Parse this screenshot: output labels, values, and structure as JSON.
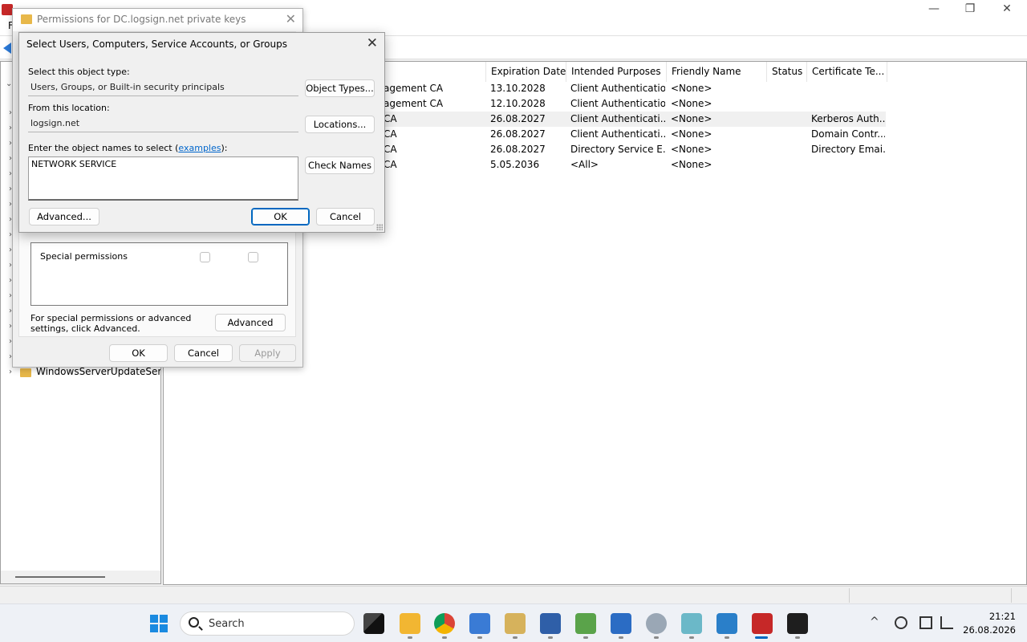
{
  "mmc": {
    "menu_first": "F",
    "window_controls": {
      "minimize": "—",
      "restore": "❐",
      "close": "✕"
    },
    "tree": {
      "folder_label": "WindowsServerUpdateService"
    },
    "columns": [
      "",
      "Expiration Date",
      "Intended Purposes",
      "Friendly Name",
      "Status",
      "Certificate Te..."
    ],
    "rows": [
      {
        "issued_by": "agement CA",
        "expiration": "13.10.2028",
        "purposes": "Client Authentication",
        "friendly": "<None>",
        "status": "",
        "template": ""
      },
      {
        "issued_by": "agement CA",
        "expiration": "12.10.2028",
        "purposes": "Client Authentication",
        "friendly": "<None>",
        "status": "",
        "template": ""
      },
      {
        "issued_by": "CA",
        "expiration": "26.08.2027",
        "purposes": "Client Authenticati...",
        "friendly": "<None>",
        "status": "",
        "template": "Kerberos Auth..."
      },
      {
        "issued_by": "CA",
        "expiration": "26.08.2027",
        "purposes": "Client Authenticati...",
        "friendly": "<None>",
        "status": "",
        "template": "Domain Contr..."
      },
      {
        "issued_by": "CA",
        "expiration": "26.08.2027",
        "purposes": "Directory Service E...",
        "friendly": "<None>",
        "status": "",
        "template": "Directory Emai..."
      },
      {
        "issued_by": "CA",
        "expiration": "5.05.2036",
        "purposes": "<All>",
        "friendly": "<None>",
        "status": "",
        "template": ""
      }
    ]
  },
  "perm_dialog": {
    "title": "Permissions for DC.logsign.net private keys",
    "close": "✕",
    "special_permissions": "Special permissions",
    "advanced_note": "For special permissions or advanced settings, click Advanced.",
    "advanced_button": "Advanced",
    "ok": "OK",
    "cancel": "Cancel",
    "apply": "Apply"
  },
  "select_dialog": {
    "title": "Select Users, Computers, Service Accounts, or Groups",
    "close": "✕",
    "object_type_label": "Select this object type:",
    "object_type_value": "Users, Groups, or Built-in security principals",
    "object_types_button": "Object Types...",
    "location_label": "From this location:",
    "location_value": "logsign.net",
    "locations_button": "Locations...",
    "names_label_prefix": "Enter the object names to select (",
    "names_label_link": "examples",
    "names_label_suffix": "):",
    "names_value": "NETWORK SERVICE",
    "check_names_button": "Check Names",
    "advanced_button": "Advanced...",
    "ok": "OK",
    "cancel": "Cancel"
  },
  "taskbar": {
    "search_label": "Search",
    "tray_chevron": "^",
    "time": "21:21",
    "date": "26.08.2026"
  },
  "colors": {
    "accent": "#0067c0",
    "link": "#0066cc",
    "windows_blue": "#1a8ae0"
  }
}
